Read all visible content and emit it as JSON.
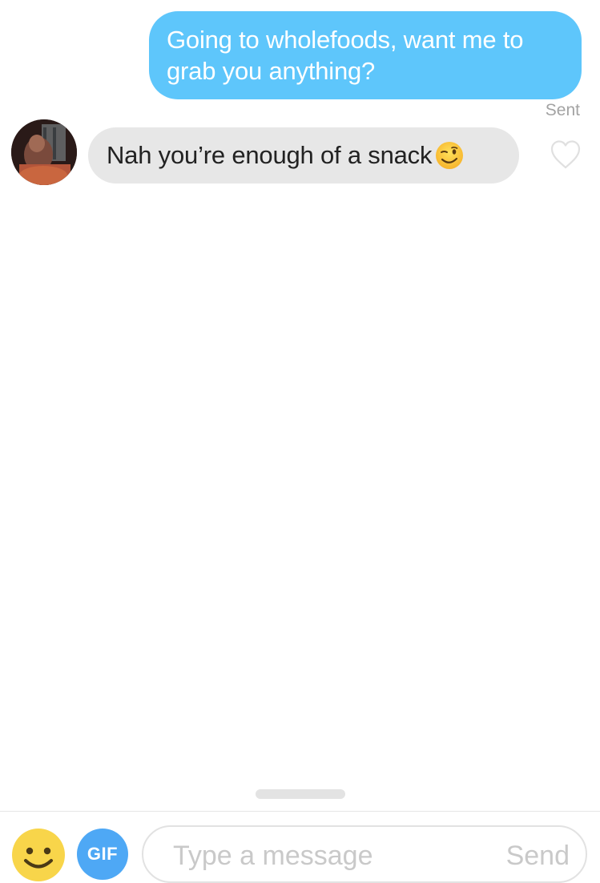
{
  "conversation": {
    "messages": [
      {
        "direction": "outgoing",
        "lines": [
          "Going to wholefoods, want me to",
          "grab you anything?"
        ],
        "status": "Sent"
      },
      {
        "direction": "incoming",
        "text": "Nah you’re enough of a snack",
        "emoji": "winking-face-emoji",
        "like_icon": "heart-outline-icon"
      }
    ]
  },
  "composer": {
    "emoji_icon": "smiley-face-icon",
    "gif_label": "GIF",
    "input_placeholder": "Type a message",
    "input_value": "",
    "send_label": "Send"
  },
  "colors": {
    "sent_bubble": "#5ec6fb",
    "received_bubble": "#e7e7e7",
    "gif_button": "#4ea8f5",
    "emoji_button": "#f8d54a",
    "muted_text": "#a3a3a3"
  }
}
